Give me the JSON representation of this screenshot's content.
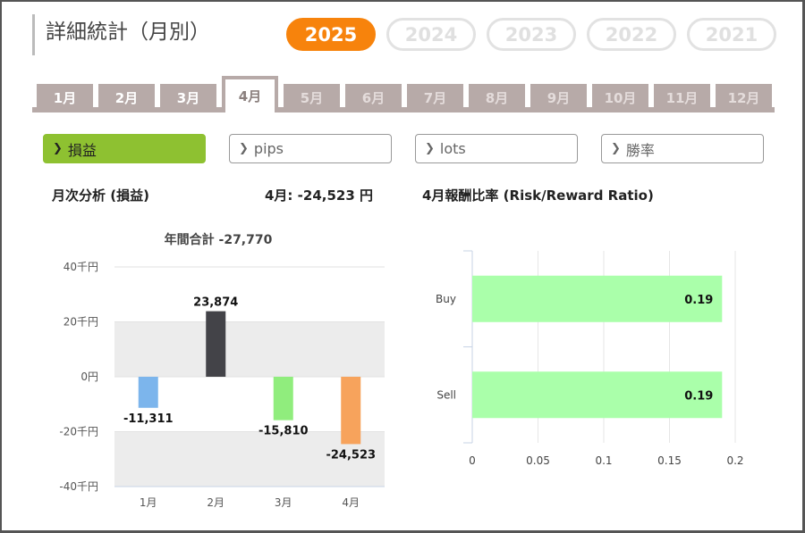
{
  "page": {
    "title": "詳細統計（月別）"
  },
  "years": [
    {
      "label": "2025",
      "active": true
    },
    {
      "label": "2024",
      "active": false
    },
    {
      "label": "2023",
      "active": false
    },
    {
      "label": "2022",
      "active": false
    },
    {
      "label": "2021",
      "active": false
    }
  ],
  "month_tabs": [
    {
      "label": "1月",
      "state": "normal"
    },
    {
      "label": "2月",
      "state": "normal"
    },
    {
      "label": "3月",
      "state": "normal"
    },
    {
      "label": "4月",
      "state": "active"
    },
    {
      "label": "5月",
      "state": "dim"
    },
    {
      "label": "6月",
      "state": "dim"
    },
    {
      "label": "7月",
      "state": "dim"
    },
    {
      "label": "8月",
      "state": "dim"
    },
    {
      "label": "9月",
      "state": "dim"
    },
    {
      "label": "10月",
      "state": "dim"
    },
    {
      "label": "11月",
      "state": "dim"
    },
    {
      "label": "12月",
      "state": "dim"
    }
  ],
  "filters": [
    {
      "label": "損益",
      "active": true
    },
    {
      "label": "pips",
      "active": false
    },
    {
      "label": "lots",
      "active": false
    },
    {
      "label": "勝率",
      "active": false
    }
  ],
  "monthly": {
    "heading": "月次分析 (損益)",
    "current_label": "4月: -24,523 円"
  },
  "ratio": {
    "heading": "4月報酬比率 (Risk/Reward Ratio)"
  },
  "colors": {
    "accent": "#f7830c",
    "filter_active": "#8ec131",
    "tab": "#b7aaa8"
  },
  "chart_data": [
    {
      "type": "bar",
      "title": "年間合計 -27,770",
      "categories": [
        "1月",
        "2月",
        "3月",
        "4月"
      ],
      "values": [
        -11311,
        23874,
        -15810,
        -24523
      ],
      "value_labels": [
        "-11,311",
        "23,874",
        "-15,810",
        "-24,523"
      ],
      "colors": [
        "#7cb5ec",
        "#434348",
        "#90ed7d",
        "#f7a35c"
      ],
      "ylim": [
        -40000,
        40000
      ],
      "yticks": [
        40000,
        20000,
        0,
        -20000,
        -40000
      ],
      "ytick_labels": [
        "40千円",
        "20千円",
        "0円",
        "-20千円",
        "-40千円"
      ],
      "banded_background": true
    },
    {
      "type": "bar",
      "orientation": "horizontal",
      "categories": [
        "Buy",
        "Sell"
      ],
      "values": [
        0.19,
        0.19
      ],
      "value_labels": [
        "0.19",
        "0.19"
      ],
      "bar_color": "#aaffaa",
      "xlim": [
        0,
        0.2
      ],
      "xticks": [
        0,
        0.05,
        0.1,
        0.15,
        0.2
      ],
      "xtick_labels": [
        "0",
        "0.05",
        "0.1",
        "0.15",
        "0.2"
      ],
      "grid": true
    }
  ]
}
